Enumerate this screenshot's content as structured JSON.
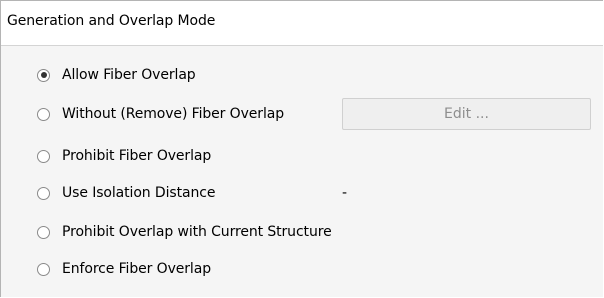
{
  "panel": {
    "title": "Generation and Overlap Mode"
  },
  "options": [
    {
      "label": "Allow Fiber Overlap",
      "selected": true
    },
    {
      "label": "Without (Remove) Fiber Overlap",
      "selected": false
    },
    {
      "label": "Prohibit Fiber Overlap",
      "selected": false
    },
    {
      "label": "Use Isolation Distance",
      "selected": false
    },
    {
      "label": "Prohibit Overlap with Current Structure",
      "selected": false
    },
    {
      "label": "Enforce Fiber Overlap",
      "selected": false
    }
  ],
  "edit_button": {
    "label": "Edit ...",
    "enabled": false
  },
  "isolation_distance": {
    "value": "-"
  }
}
